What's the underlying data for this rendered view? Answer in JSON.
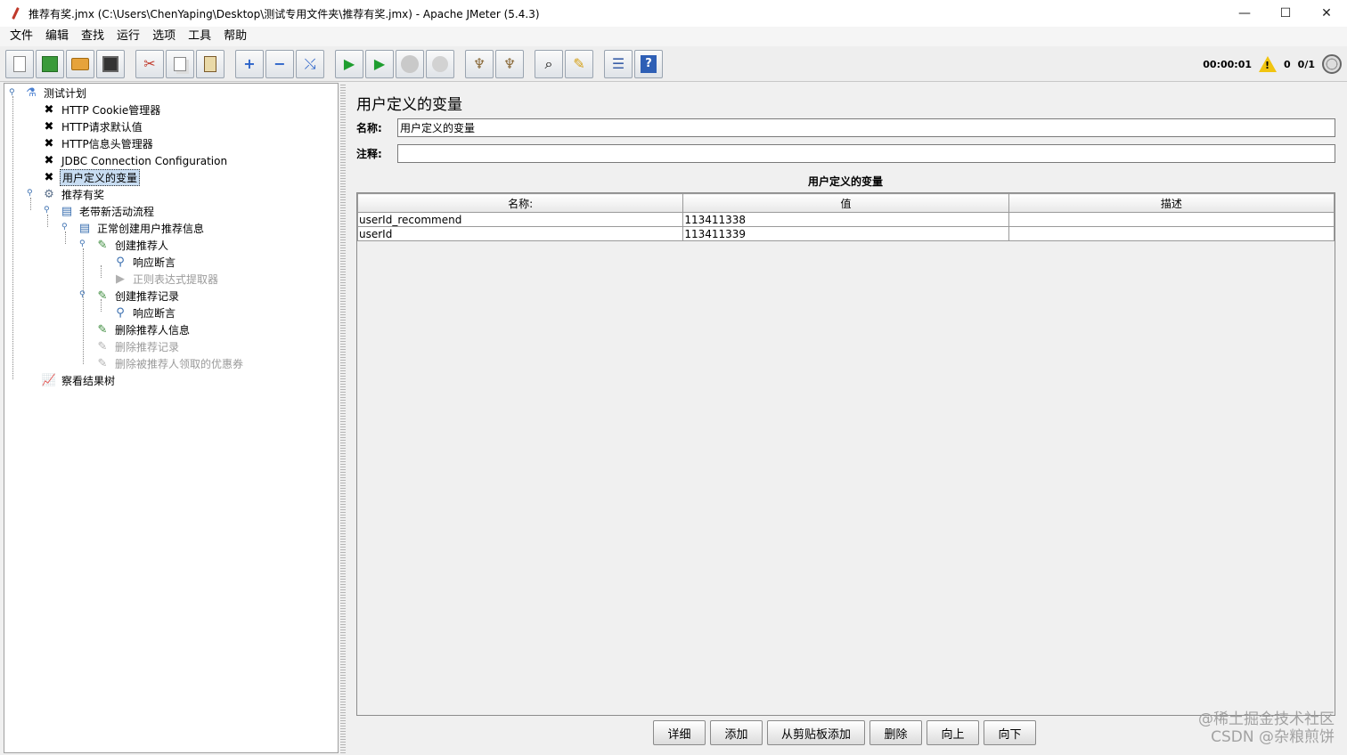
{
  "window": {
    "title": "推荐有奖.jmx (C:\\Users\\ChenYaping\\Desktop\\测试专用文件夹\\推荐有奖.jmx) - Apache JMeter (5.4.3)",
    "minimize": "—",
    "maximize": "☐",
    "close": "✕"
  },
  "menu": [
    "文件",
    "编辑",
    "查找",
    "运行",
    "选项",
    "工具",
    "帮助"
  ],
  "status": {
    "elapsed": "00:00:01",
    "warnings": "0",
    "threads": "0/1"
  },
  "tree": [
    {
      "label": "测试计划",
      "icon": "test-plan-icon",
      "disabled": false
    },
    {
      "label": "HTTP Cookie管理器",
      "icon": "config-icon",
      "disabled": false
    },
    {
      "label": "HTTP请求默认值",
      "icon": "config-icon",
      "disabled": false
    },
    {
      "label": "HTTP信息头管理器",
      "icon": "config-icon",
      "disabled": false
    },
    {
      "label": "JDBC Connection Configuration",
      "icon": "config-icon",
      "disabled": false
    },
    {
      "label": "用户定义的变量",
      "icon": "config-icon",
      "disabled": false,
      "selected": true
    },
    {
      "label": "推荐有奖",
      "icon": "thread-group-icon",
      "disabled": false
    },
    {
      "label": "老带新活动流程",
      "icon": "controller-icon",
      "disabled": false
    },
    {
      "label": "正常创建用户推荐信息",
      "icon": "controller-icon",
      "disabled": false
    },
    {
      "label": "创建推荐人",
      "icon": "sampler-icon",
      "disabled": false
    },
    {
      "label": "响应断言",
      "icon": "assertion-icon",
      "disabled": false
    },
    {
      "label": "正则表达式提取器",
      "icon": "extractor-icon",
      "disabled": true
    },
    {
      "label": "创建推荐记录",
      "icon": "sampler-icon",
      "disabled": false
    },
    {
      "label": "响应断言",
      "icon": "assertion-icon",
      "disabled": false
    },
    {
      "label": "删除推荐人信息",
      "icon": "sampler-icon",
      "disabled": false
    },
    {
      "label": "删除推荐记录",
      "icon": "sampler-icon",
      "disabled": true
    },
    {
      "label": "删除被推荐人领取的优惠券",
      "icon": "sampler-icon",
      "disabled": true
    },
    {
      "label": "察看结果树",
      "icon": "listener-icon",
      "disabled": false
    }
  ],
  "panel": {
    "title": "用户定义的变量",
    "name_label": "名称:",
    "name_value": "用户定义的变量",
    "comment_label": "注释:",
    "comment_value": "",
    "section_title": "用户定义的变量",
    "columns": [
      "名称:",
      "值",
      "描述"
    ],
    "rows": [
      [
        "userId_recommend",
        "113411338",
        ""
      ],
      [
        "userId",
        "113411339",
        ""
      ]
    ],
    "buttons": [
      "详细",
      "添加",
      "从剪贴板添加",
      "删除",
      "向上",
      "向下"
    ]
  },
  "watermark": {
    "line1": "@稀土掘金技术社区",
    "line2": "CSDN @杂粮煎饼"
  },
  "colors": {
    "selection": "#c8ddf2",
    "run_green": "#1e9e2f",
    "disabled_text": "#9a9a9a"
  }
}
